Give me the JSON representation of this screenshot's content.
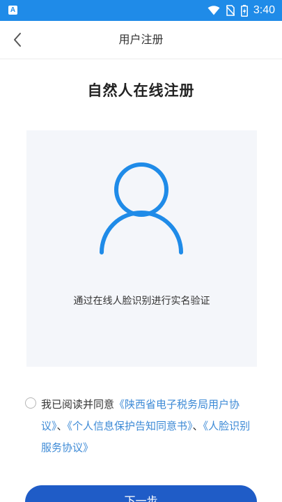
{
  "status_bar": {
    "app_icon_letter": "A",
    "time": "3:40"
  },
  "nav": {
    "title": "用户注册"
  },
  "main": {
    "title": "自然人在线注册",
    "face_caption": "通过在线人脸识别进行实名验证"
  },
  "agreement": {
    "prefix": "我已阅读并同意",
    "link1": "《陕西省电子税务局用户协议》",
    "sep1": "、",
    "link2": "《个人信息保护告知同意书》",
    "sep2": "、",
    "link3": "《人脸识别服务协议》"
  },
  "next_button": {
    "label": "下一步"
  },
  "colors": {
    "status_bar": "#1f8be8",
    "accent_icon": "#1f8be8",
    "link": "#3d8ad6",
    "button": "#1f5cc7",
    "card_bg": "#f4f6fa"
  }
}
